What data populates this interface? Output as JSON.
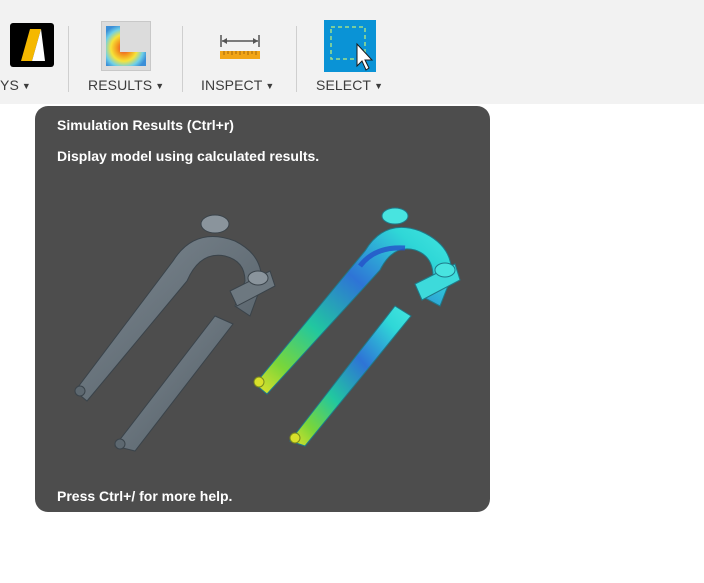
{
  "toolbar": {
    "groups": [
      {
        "label": "YS",
        "icon": "analysis-logo-icon"
      },
      {
        "label": "RESULTS",
        "icon": "results-contour-icon"
      },
      {
        "label": "INSPECT",
        "icon": "ruler-measure-icon"
      },
      {
        "label": "SELECT",
        "icon": "selection-cursor-icon"
      }
    ]
  },
  "tooltip": {
    "title": "Simulation Results (Ctrl+r)",
    "description": "Display model using calculated results.",
    "help": "Press Ctrl+/ for more help.",
    "image_icons": [
      "fork-model-gray-icon",
      "fork-model-stress-contour-icon"
    ]
  },
  "colors": {
    "toolbar_bg": "#f2f2f2",
    "tooltip_bg": "#4d4d4d",
    "select_blue": "#0a93d6",
    "ruler_orange": "#f2a516"
  }
}
